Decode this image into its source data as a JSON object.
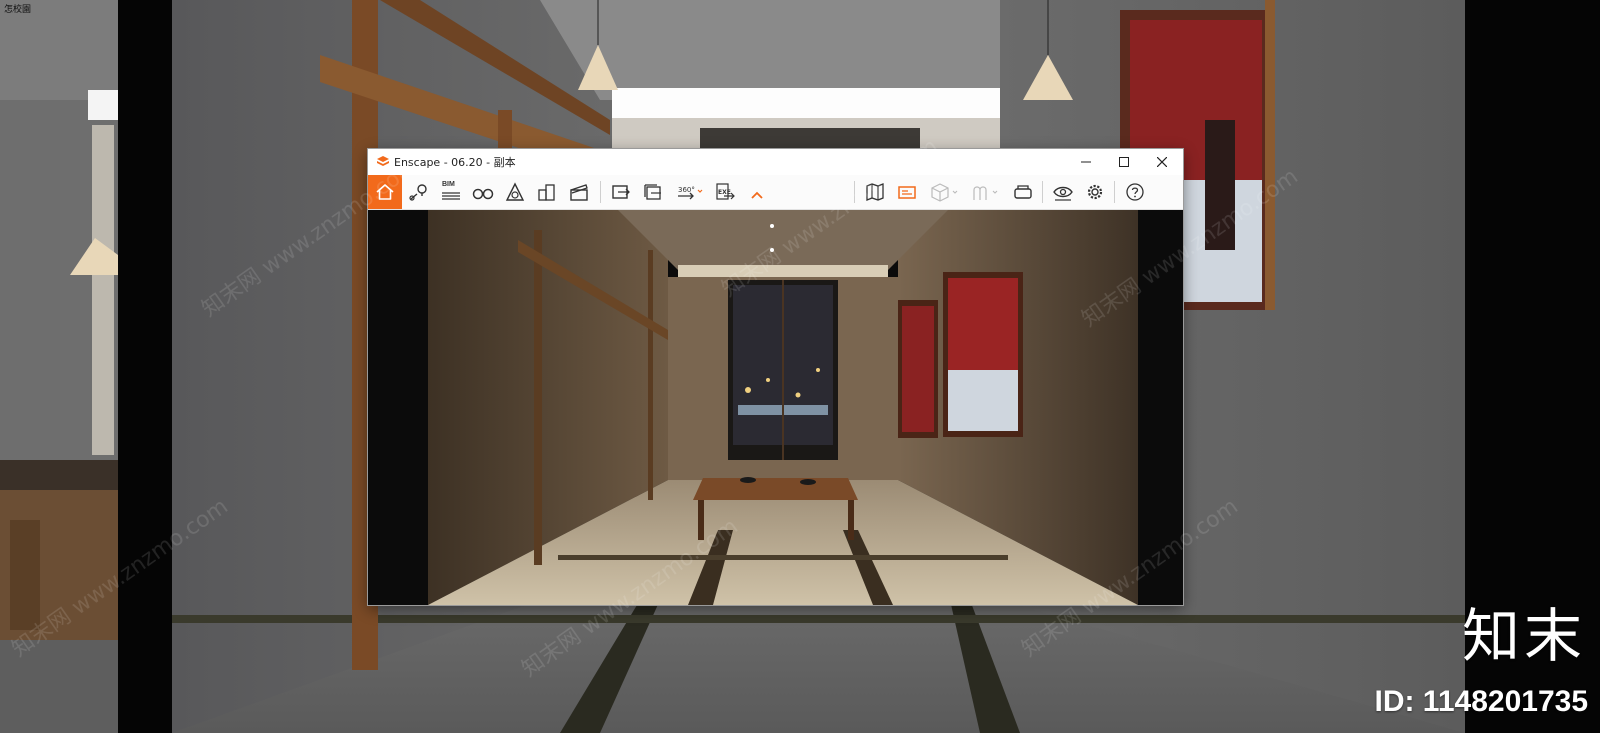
{
  "corner_label": "怎校園",
  "window": {
    "title": "Enscape - 06.20 - 副本",
    "controls": [
      "minimize-icon",
      "maximize-icon",
      "close-icon"
    ]
  },
  "toolbar": {
    "bim_label": "BIM",
    "panorama_label": "360°",
    "exe_label": "EXE",
    "accent": "#f26a1b",
    "buttons": [
      "home-icon",
      "location-pin-icon",
      "bim-list-icon",
      "binoculars-icon",
      "perspective-icon",
      "buildings-icon",
      "clapperboard-icon",
      "screenshot-export-icon",
      "batch-render-icon",
      "panorama-icon",
      "exe-export-icon",
      "collapse-icon",
      "map-icon",
      "sun-panel-icon",
      "cube-icon",
      "arches-icon",
      "vr-headset-icon",
      "eye-icon",
      "gear-icon",
      "help-icon"
    ]
  },
  "watermark": {
    "text": "知末网 www.znzmo.com",
    "brand": "知末",
    "id_text": "ID: 1148201735"
  }
}
